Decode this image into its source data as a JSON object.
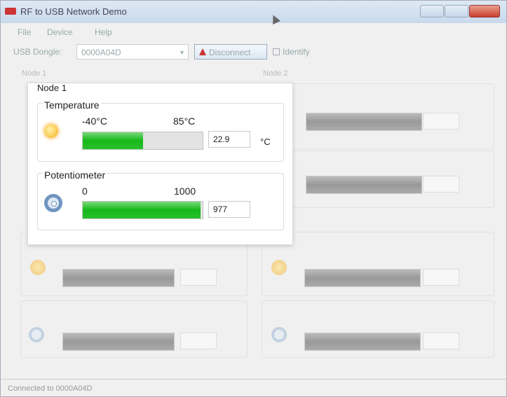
{
  "window": {
    "title": "RF to USB Network Demo"
  },
  "menu": {
    "items": [
      "File",
      "Device",
      "Help"
    ]
  },
  "toolbar": {
    "dongle_label": "USB Dongle:",
    "dongle_value": "0000A04D",
    "disconnect_label": "Disconnect",
    "identify_label": "Identify"
  },
  "nodes_bg": {
    "node1": "Node 1",
    "node2": "Node 2"
  },
  "popup": {
    "title": "Node 1",
    "temperature": {
      "label": "Temperature",
      "min": "-40°C",
      "max": "85°C",
      "value": "22.9",
      "unit": "°C",
      "fill_percent": 50
    },
    "potentiometer": {
      "label": "Potentiometer",
      "min": "0",
      "max": "1000",
      "value": "977",
      "fill_percent": 98
    }
  },
  "status": {
    "text": "Connected to 0000A04D"
  },
  "colors": {
    "gauge_fill": "#1bb81e",
    "close_button": "#c8402c"
  }
}
